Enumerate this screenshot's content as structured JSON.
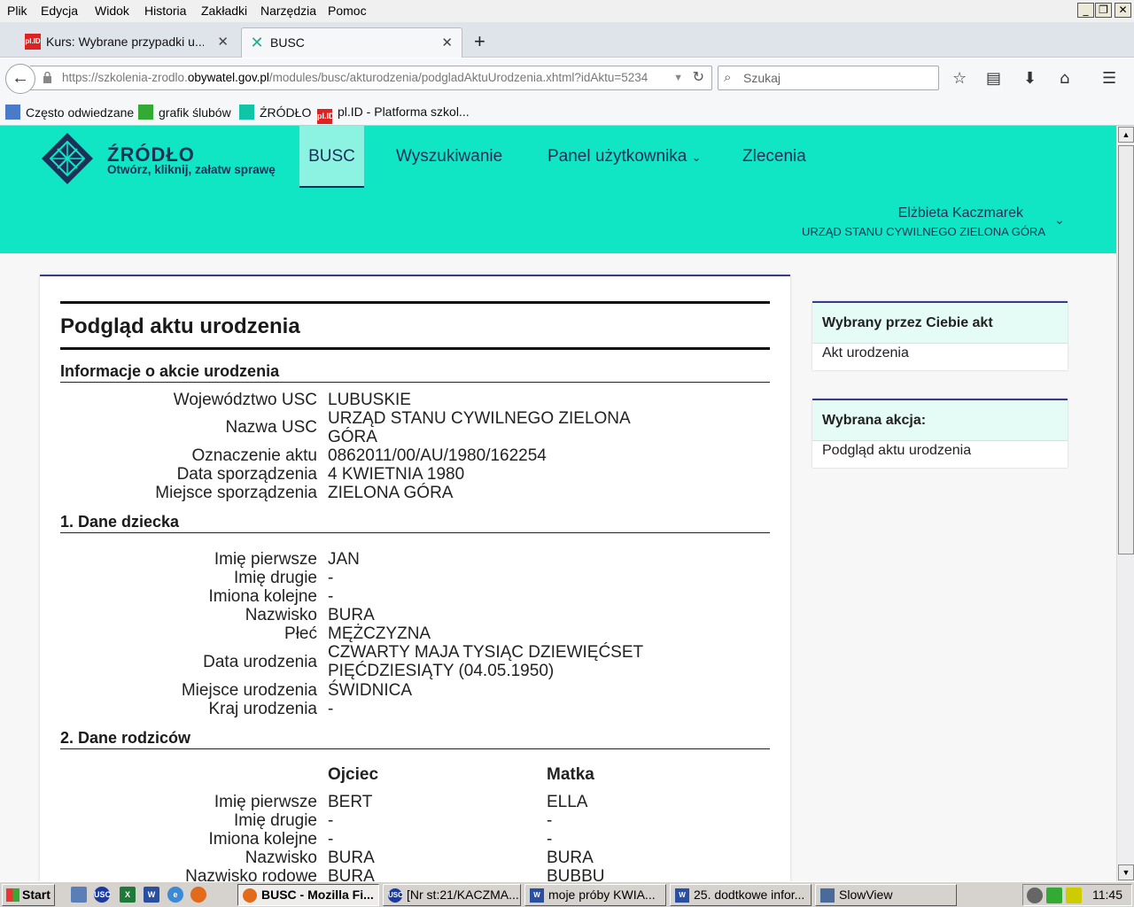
{
  "browser": {
    "menu": [
      "Plik",
      "Edycja",
      "Widok",
      "Historia",
      "Zakładki",
      "Narzędzia",
      "Pomoc"
    ],
    "tabs": [
      {
        "title": "Kurs: Wybrane przypadki u...",
        "icon": "plid-icon"
      },
      {
        "title": "BUSC",
        "icon": "zrodlo-icon"
      }
    ],
    "url_prefix": "https://szkolenia-zrodlo.",
    "url_domain": "obywatel.gov.pl",
    "url_path": "/modules/busc/akturodzenia/podgladAktuUrodzenia.xhtml?idAktu=5234",
    "search_placeholder": "Szukaj",
    "bookmarks": [
      "Często odwiedzane",
      "grafik ślubów",
      "ŹRÓDŁO",
      "pl.ID - Platforma szkol..."
    ]
  },
  "site": {
    "brand_name": "ŹRÓDŁO",
    "brand_tagline": "Otwórz, kliknij, załatw sprawę",
    "nav": [
      "BUSC",
      "Wyszukiwanie",
      "Panel użytkownika",
      "Zlecenia"
    ],
    "user_name": "Elżbieta Kaczmarek",
    "user_office": "URZĄD STANU CYWILNEGO ZIELONA GÓRA"
  },
  "main": {
    "title": "Podgląd aktu urodzenia",
    "info_header": "Informacje o akcie urodzenia",
    "info": [
      {
        "label": "Województwo USC",
        "value": "LUBUSKIE"
      },
      {
        "label": "Nazwa USC",
        "value": "URZĄD STANU CYWILNEGO ZIELONA GÓRA"
      },
      {
        "label": "Oznaczenie aktu",
        "value": "0862011/00/AU/1980/162254"
      },
      {
        "label": "Data sporządzenia",
        "value": "4 KWIETNIA 1980"
      },
      {
        "label": "Miejsce sporządzenia",
        "value": "ZIELONA GÓRA"
      }
    ],
    "child_header": "1. Dane dziecka",
    "child": [
      {
        "label": "Imię pierwsze",
        "value": "JAN"
      },
      {
        "label": "Imię drugie",
        "value": "-"
      },
      {
        "label": "Imiona kolejne",
        "value": "-"
      },
      {
        "label": "Nazwisko",
        "value": "BURA"
      },
      {
        "label": "Płeć",
        "value": "MĘŻCZYZNA"
      },
      {
        "label": "Data urodzenia",
        "value": "CZWARTY MAJA TYSIĄC DZIEWIĘĆSET PIĘĆDZIESIĄTY (04.05.1950)"
      },
      {
        "label": "Miejsce urodzenia",
        "value": "ŚWIDNICA"
      },
      {
        "label": "Kraj urodzenia",
        "value": "-"
      }
    ],
    "parents_header": "2. Dane rodziców",
    "father_header": "Ojciec",
    "mother_header": "Matka",
    "parents": [
      {
        "label": "Imię pierwsze",
        "father": "BERT",
        "mother": "ELLA"
      },
      {
        "label": "Imię drugie",
        "father": "-",
        "mother": "-"
      },
      {
        "label": "Imiona kolejne",
        "father": "-",
        "mother": "-"
      },
      {
        "label": "Nazwisko",
        "father": "BURA",
        "mother": "BURA"
      },
      {
        "label": "Nazwisko rodowe",
        "father": "BURA",
        "mother": "BUBBU"
      }
    ]
  },
  "sidebar": {
    "selected_act_title": "Wybrany przez Ciebie akt",
    "selected_act_value": "Akt urodzenia",
    "selected_action_title": "Wybrana akcja:",
    "selected_action_value": "Podgląd aktu urodzenia"
  },
  "taskbar": {
    "start": "Start",
    "tasks": [
      "BUSC - Mozilla Fi...",
      "[Nr st:21/KACZMA...",
      "moje próby KWIA...",
      "25. dodtkowe infor...",
      "SlowView"
    ],
    "clock": "11:45"
  },
  "colors": {
    "header_bg": "#10e5c4",
    "brand_navy": "#1c3058",
    "card_border": "#3b3a8a"
  }
}
